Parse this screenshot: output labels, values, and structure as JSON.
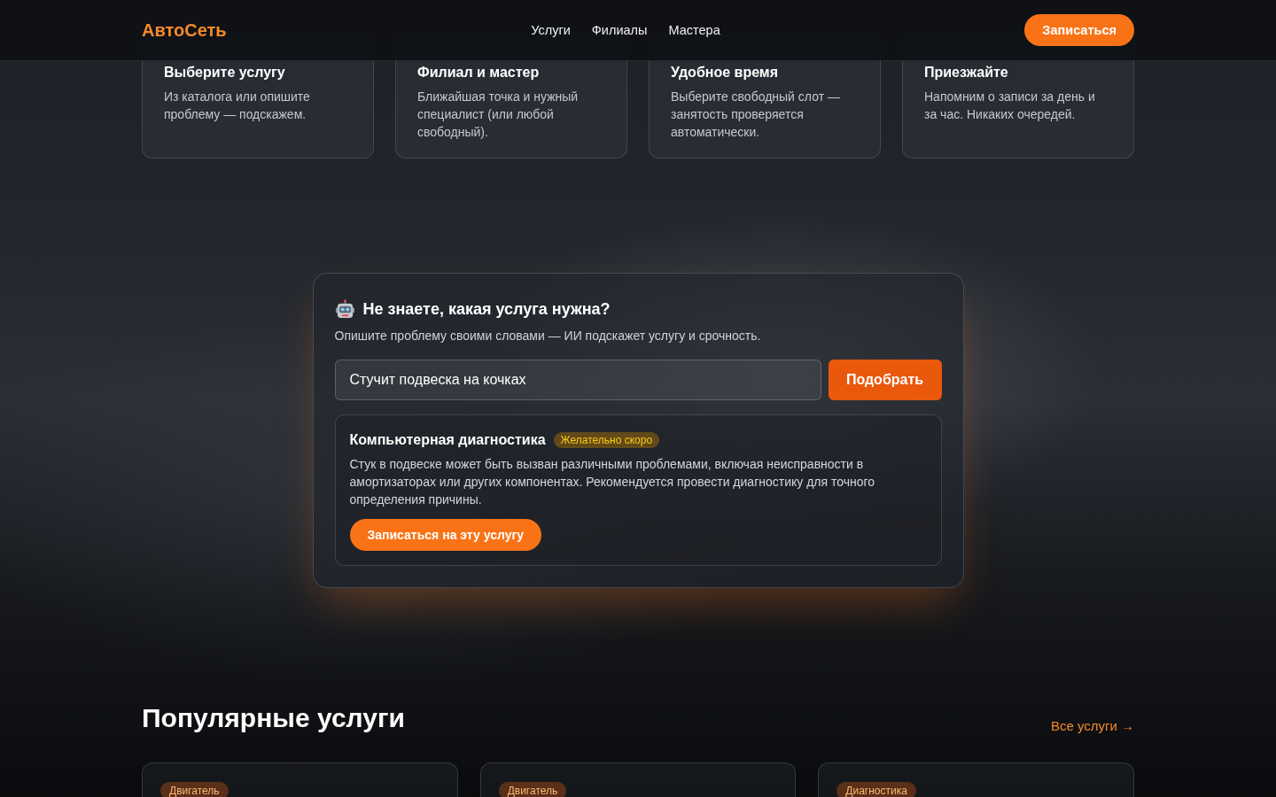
{
  "header": {
    "logo": "АвтоСеть",
    "nav": [
      {
        "label": "Услуги"
      },
      {
        "label": "Филиалы"
      },
      {
        "label": "Мастера"
      }
    ],
    "cta": "Записаться"
  },
  "steps": [
    {
      "title": "Выберите услугу",
      "text": "Из каталога или опишите проблему — подскажем."
    },
    {
      "title": "Филиал и мастер",
      "text": "Ближайшая точка и нужный специалист (или любой свободный)."
    },
    {
      "title": "Удобное время",
      "text": "Выберите свободный слот — занятость проверяется автоматически."
    },
    {
      "title": "Приезжайте",
      "text": "Напомним о записи за день и за час. Никаких очередей."
    }
  ],
  "ai_helper": {
    "title": "Не знаете, какая услуга нужна?",
    "subtitle": "Опишите проблему своими словами — ИИ подскажет услугу и срочность.",
    "input": {
      "value": "Стучит подвеска на кочках"
    },
    "button": "Подобрать",
    "result": {
      "title": "Компьютерная диагностика",
      "badge": "Желательно скоро",
      "text": "Стук в подвеске может быть вызван различными проблемами, включая неисправности в амортизаторах или других компонентах. Рекомендуется провести диагностику для точного определения причины.",
      "button": "Записаться на эту услугу"
    }
  },
  "popular": {
    "title": "Популярные услуги",
    "link": "Все услуги →",
    "cards": [
      {
        "tag": "Двигатель"
      },
      {
        "tag": "Двигатель"
      },
      {
        "tag": "Диагностика"
      }
    ]
  }
}
